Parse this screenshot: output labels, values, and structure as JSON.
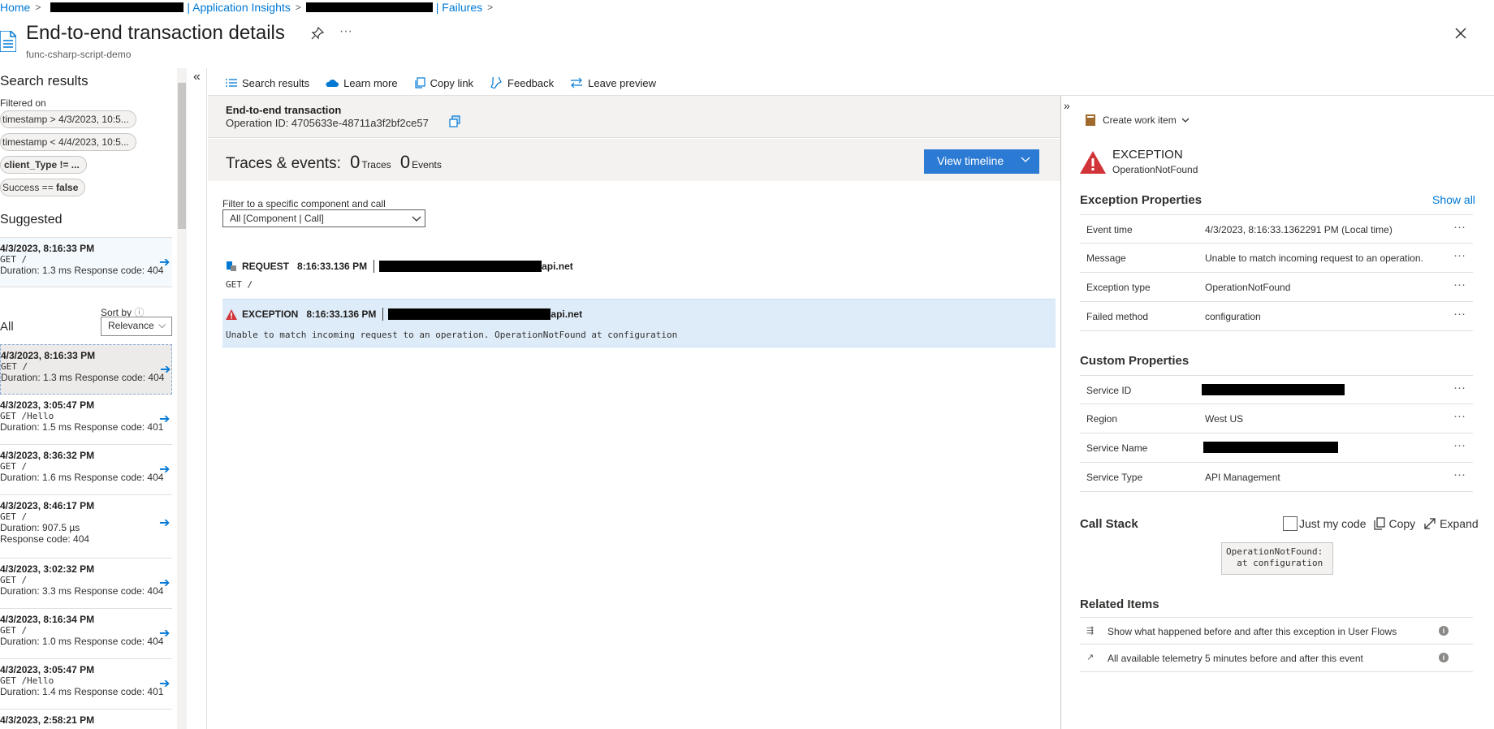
{
  "breadcrumb": {
    "home": "Home",
    "app_insights": "| Application Insights",
    "failures": "| Failures"
  },
  "header": {
    "title": "End-to-end transaction details",
    "subtitle": "func-csharp-script-demo"
  },
  "left": {
    "search_heading": "Search results",
    "filtered_on": "Filtered on",
    "pills": [
      {
        "prefix": "timestamp > 4/3/2023, 10:5...",
        "bold": ""
      },
      {
        "prefix": "timestamp < 4/4/2023, 10:5...",
        "bold": ""
      },
      {
        "prefix": "",
        "bold": "client_Type != ..."
      },
      {
        "prefix": "Success == ",
        "bold": "false"
      }
    ],
    "suggested_heading": "Suggested",
    "suggested": {
      "ts": "4/3/2023, 8:16:33 PM",
      "method": "GET /",
      "meta": "Duration: 1.3 ms  Response code: 404"
    },
    "all_label": "All",
    "sort_by_label": "Sort by",
    "sort_value": "Relevance",
    "results": [
      {
        "ts": "4/3/2023, 8:16:33 PM",
        "method": "GET /",
        "meta": "Duration: 1.3 ms  Response code: 404",
        "meta2": ""
      },
      {
        "ts": "4/3/2023, 3:05:47 PM",
        "method": "GET /Hello",
        "meta": "Duration: 1.5 ms  Response code: 401",
        "meta2": ""
      },
      {
        "ts": "4/3/2023, 8:36:32 PM",
        "method": "GET /",
        "meta": "Duration: 1.6 ms  Response code: 404",
        "meta2": ""
      },
      {
        "ts": "4/3/2023, 8:46:17 PM",
        "method": "GET /",
        "meta": "Duration: 907.5 µs",
        "meta2": "Response code: 404"
      },
      {
        "ts": "4/3/2023, 3:02:32 PM",
        "method": "GET /",
        "meta": "Duration: 3.3 ms  Response code: 404",
        "meta2": ""
      },
      {
        "ts": "4/3/2023, 8:16:34 PM",
        "method": "GET /",
        "meta": "Duration: 1.0 ms  Response code: 404",
        "meta2": ""
      },
      {
        "ts": "4/3/2023, 3:05:47 PM",
        "method": "GET /Hello",
        "meta": "Duration: 1.4 ms  Response code: 401",
        "meta2": ""
      },
      {
        "ts": "4/3/2023, 2:58:21 PM",
        "method": "",
        "meta": "",
        "meta2": ""
      }
    ]
  },
  "toolbar": {
    "search_results": "Search results",
    "learn_more": "Learn more",
    "copy_link": "Copy link",
    "feedback": "Feedback",
    "leave_preview": "Leave preview"
  },
  "transaction": {
    "title": "End-to-end transaction",
    "operation_id": "Operation ID: 4705633e-48711a3f2bf2ce57",
    "traces_label": "Traces & events:",
    "traces_count": "0",
    "traces_word": "Traces",
    "events_count": "0",
    "events_word": "Events",
    "view_timeline": "View timeline",
    "filter_label": "Filter to a specific component and call",
    "filter_value": "All [Component | Call]",
    "request": {
      "type": "REQUEST",
      "time": "8:16:33.136 PM",
      "host_suffix": "api.net",
      "body": "GET /"
    },
    "exception": {
      "type": "EXCEPTION",
      "time": "8:16:33.136 PM",
      "host_suffix": "api.net",
      "body": "Unable to match incoming request to an operation. OperationNotFound at configuration"
    }
  },
  "detail": {
    "create_work_item": "Create work item",
    "exception_title": "EXCEPTION",
    "exception_sub": "OperationNotFound",
    "exception_props_heading": "Exception Properties",
    "show_all": "Show all",
    "exception_props": [
      {
        "k": "Event time",
        "v": "4/3/2023, 8:16:33.1362291 PM (Local time)"
      },
      {
        "k": "Message",
        "v": "Unable to match incoming request to an operation."
      },
      {
        "k": "Exception type",
        "v": "OperationNotFound"
      },
      {
        "k": "Failed method",
        "v": "configuration"
      }
    ],
    "custom_props_heading": "Custom Properties",
    "custom_props": [
      {
        "k": "Service ID",
        "v": ""
      },
      {
        "k": "Region",
        "v": "West US"
      },
      {
        "k": "Service Name",
        "v": ""
      },
      {
        "k": "Service Type",
        "v": "API Management"
      }
    ],
    "call_stack_heading": "Call Stack",
    "just_my_code": "Just my code",
    "copy": "Copy",
    "expand": "Expand",
    "stack_text": "OperationNotFound:\n  at configuration",
    "related_heading": "Related Items",
    "related": [
      {
        "t": "Show what happened before and after this exception in User Flows"
      },
      {
        "t": "All available telemetry 5 minutes before and after this event"
      }
    ]
  },
  "colors": {
    "accent": "#0078d4",
    "button": "#2b7bd4",
    "error": "#d13438"
  }
}
